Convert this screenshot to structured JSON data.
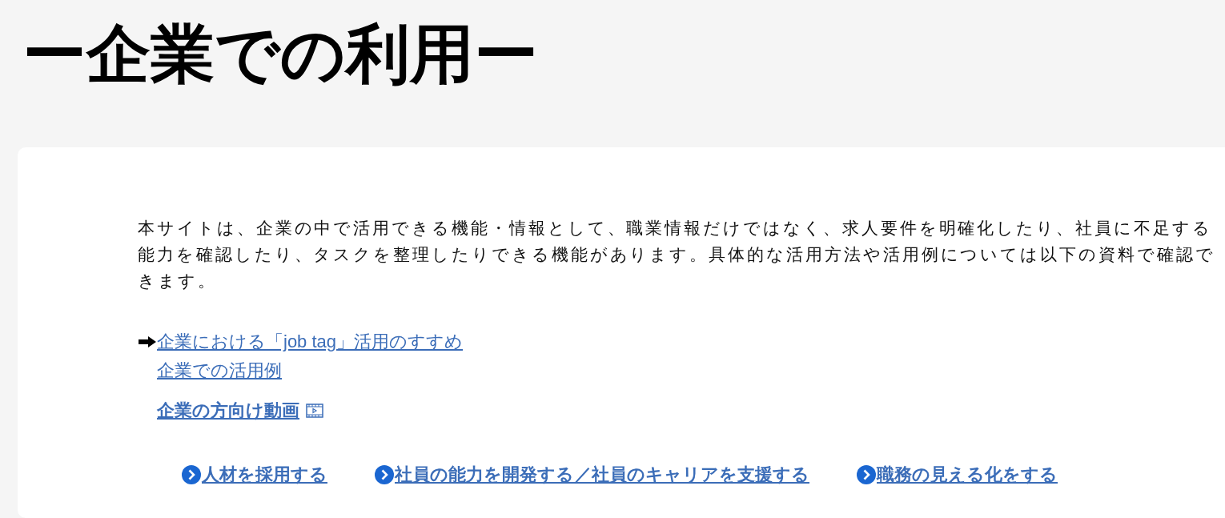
{
  "heading": "ー企業での利用ー",
  "intro": "本サイトは、企業の中で活用できる機能・情報として、職業情報だけではなく、求人要件を明確化したり、社員に不足する能力を確認したり、タスクを整理したりできる機能があります。具体的な活用方法や活用例については以下の資料で確認できます。",
  "resource_links": [
    {
      "label": "企業における「job tag」活用のすすめ",
      "kind": "arrow"
    },
    {
      "label": "企業での活用例",
      "kind": "plain"
    },
    {
      "label": "企業の方向け動画",
      "kind": "video"
    }
  ],
  "nav_links": [
    {
      "label": "人材を採用する"
    },
    {
      "label": "社員の能力を開発する／社員のキャリアを支援する"
    },
    {
      "label": "職務の見える化をする"
    }
  ]
}
